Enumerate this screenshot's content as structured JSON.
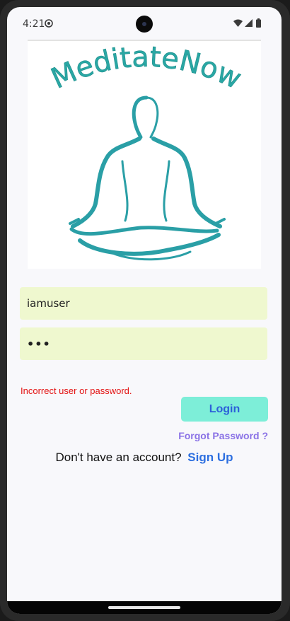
{
  "status_bar": {
    "time": "4:21",
    "icons": [
      "sync-icon",
      "camera-icon",
      "wifi-icon",
      "signal-icon",
      "battery-icon"
    ]
  },
  "logo": {
    "text": "MeditateNow",
    "color": "#2aa7a4"
  },
  "form": {
    "username_value": "iamuser",
    "password_value": "•••",
    "error_message": "Incorrect user or password.",
    "login_label": "Login",
    "forgot_label": "Forgot Password ?"
  },
  "signup": {
    "prompt": "Don't have an account?",
    "link_label": "Sign Up"
  },
  "colors": {
    "input_bg": "#eff8cf",
    "login_bg": "#7deed8",
    "login_text": "#2c5fd9",
    "error": "#e31212",
    "forgot": "#8a72e6",
    "signup_link": "#2d6fe0"
  }
}
